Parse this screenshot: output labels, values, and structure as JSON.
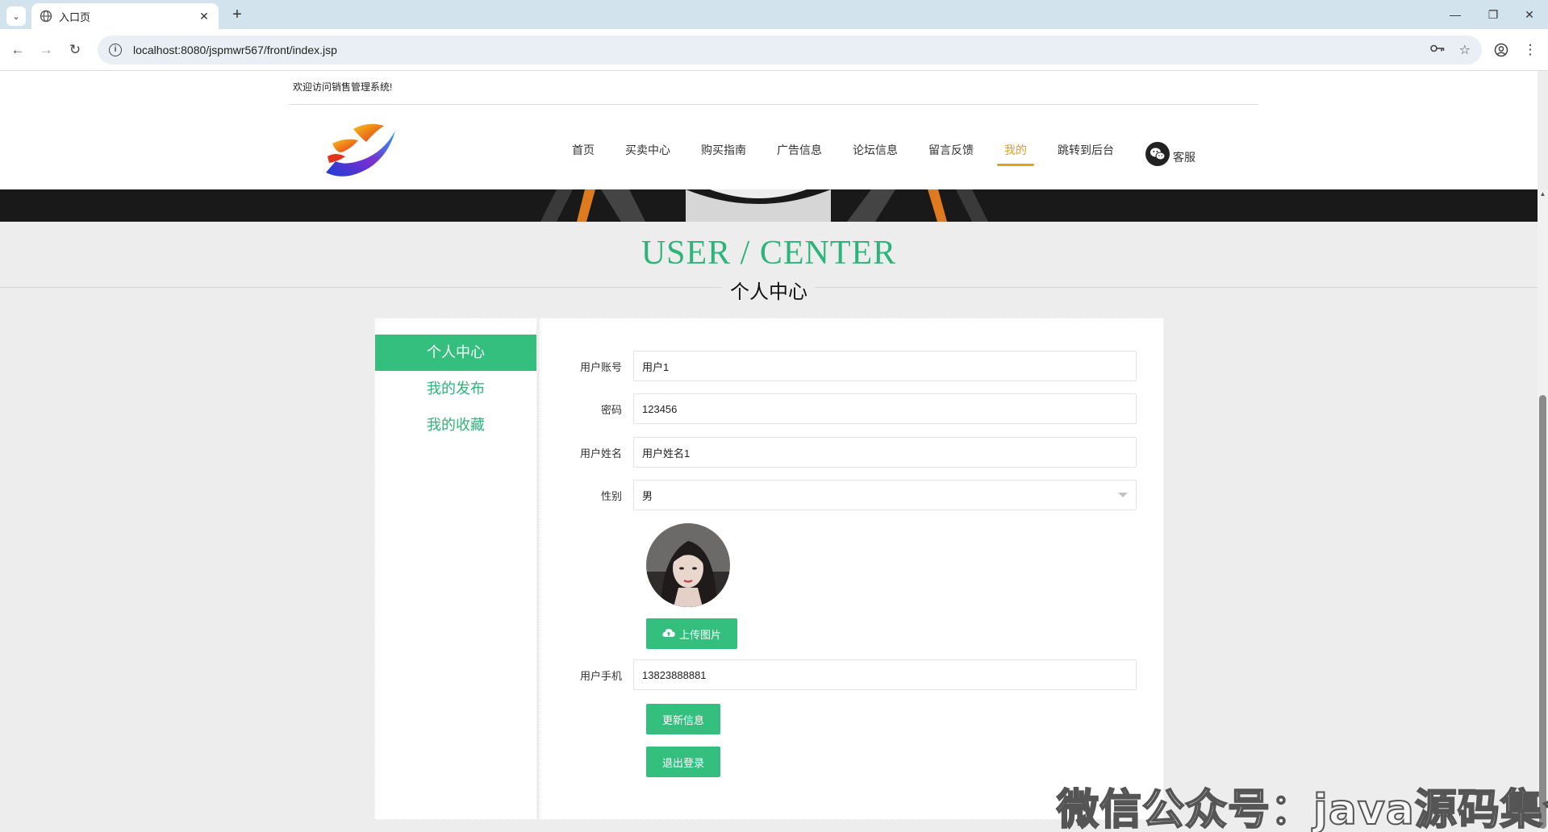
{
  "browser": {
    "tab_title": "入口页",
    "new_tab_glyph": "+",
    "close_tab_glyph": "✕",
    "url": "localhost:8080/jspmwr567/front/index.jsp",
    "window_controls": {
      "minimize": "—",
      "restore": "❐",
      "close": "✕"
    }
  },
  "site": {
    "welcome": "欢迎访问销售管理系统!",
    "nav": [
      {
        "label": "首页"
      },
      {
        "label": "买卖中心"
      },
      {
        "label": "购买指南"
      },
      {
        "label": "广告信息"
      },
      {
        "label": "论坛信息"
      },
      {
        "label": "留言反馈"
      },
      {
        "label": "我的",
        "active": true
      },
      {
        "label": "跳转到后台"
      }
    ],
    "service_label": "客服",
    "accent_color": "#2eb37a",
    "active_nav_color": "#e0a21a"
  },
  "section": {
    "title_en": "USER / CENTER",
    "title_cn": "个人中心"
  },
  "sidebar": {
    "items": [
      {
        "label": "个人中心",
        "active": true
      },
      {
        "label": "我的发布"
      },
      {
        "label": "我的收藏"
      }
    ]
  },
  "form": {
    "account_label": "用户账号",
    "account_value": "用户1",
    "password_label": "密码",
    "password_value": "123456",
    "name_label": "用户姓名",
    "name_value": "用户姓名1",
    "gender_label": "性别",
    "gender_value": "男",
    "upload_button": "上传图片",
    "phone_label": "用户手机",
    "phone_value": "13823888881",
    "update_button": "更新信息",
    "logout_button": "退出登录"
  },
  "watermark": "微信公众号：java源码集合"
}
